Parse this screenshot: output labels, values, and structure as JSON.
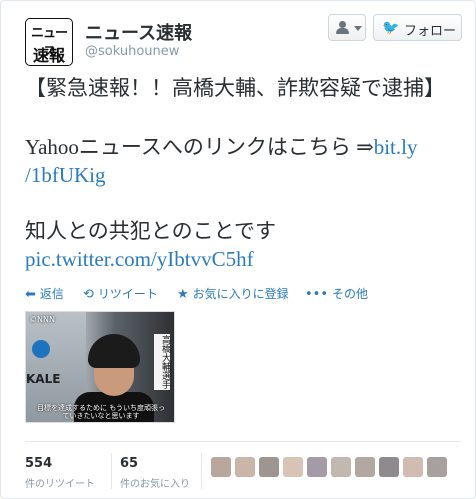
{
  "header": {
    "avatar_line1": "ニュース",
    "avatar_line2": "速報",
    "display_name": "ニュース速報",
    "handle": "@sokuhounew",
    "follow_label": "フォロー",
    "bird_glyph": "🐦",
    "user_menu_icon": "user-icon"
  },
  "tweet": {
    "line1": "【緊急速報！！高橋大輔、詐欺容疑で逮捕】",
    "line2_text": "Yahooニュースへのリンクはこちら ⇒",
    "line2_link": "bit.ly",
    "line3_link": "/1bfUKig",
    "line4": "知人との共犯とのことです",
    "line5_link": "pic.twitter.com/yIbtvvC5hf"
  },
  "actions": [
    {
      "icon": "reply-icon",
      "glyph": "⬅",
      "label": "返信"
    },
    {
      "icon": "retweet-icon",
      "glyph": "⟲",
      "label": "リツイート"
    },
    {
      "icon": "star-icon",
      "glyph": "★",
      "label": "お気に入りに登録"
    },
    {
      "icon": "more-icon",
      "glyph": "•••",
      "label": "その他"
    }
  ],
  "photo": {
    "watermark": "©NNN",
    "logo_text": "KALE",
    "caption_vertical": "高橋大輔選手",
    "subtitle": "目標を達成するために もういち度頑張っていきたいなと思います"
  },
  "stats": {
    "retweets_count": "554",
    "retweets_label": "件のリツイート",
    "favorites_count": "65",
    "favorites_label": "件のお気に入り"
  },
  "colors": {
    "link": "#2a7bbd",
    "follow_bird": "#55acee"
  }
}
